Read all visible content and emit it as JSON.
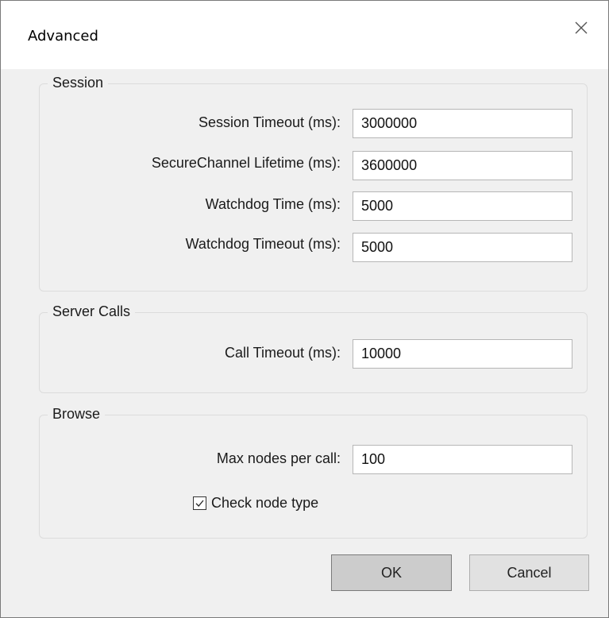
{
  "window": {
    "title": "Advanced",
    "close_icon": "close-icon"
  },
  "session": {
    "label": "Session",
    "fields": [
      {
        "label": "Session Timeout (ms):",
        "value": "3000000"
      },
      {
        "label": "SecureChannel Lifetime (ms):",
        "value": "3600000"
      },
      {
        "label": "Watchdog Time (ms):",
        "value": "5000"
      },
      {
        "label": "Watchdog Timeout (ms):",
        "value": "5000"
      }
    ]
  },
  "server_calls": {
    "label": "Server Calls",
    "fields": [
      {
        "label": "Call Timeout (ms):",
        "value": "10000"
      }
    ]
  },
  "browse": {
    "label": "Browse",
    "fields": [
      {
        "label": "Max nodes per call:",
        "value": "100"
      }
    ],
    "check_node_type": {
      "label": "Check node type",
      "checked": true
    }
  },
  "buttons": {
    "ok": "OK",
    "cancel": "Cancel"
  }
}
